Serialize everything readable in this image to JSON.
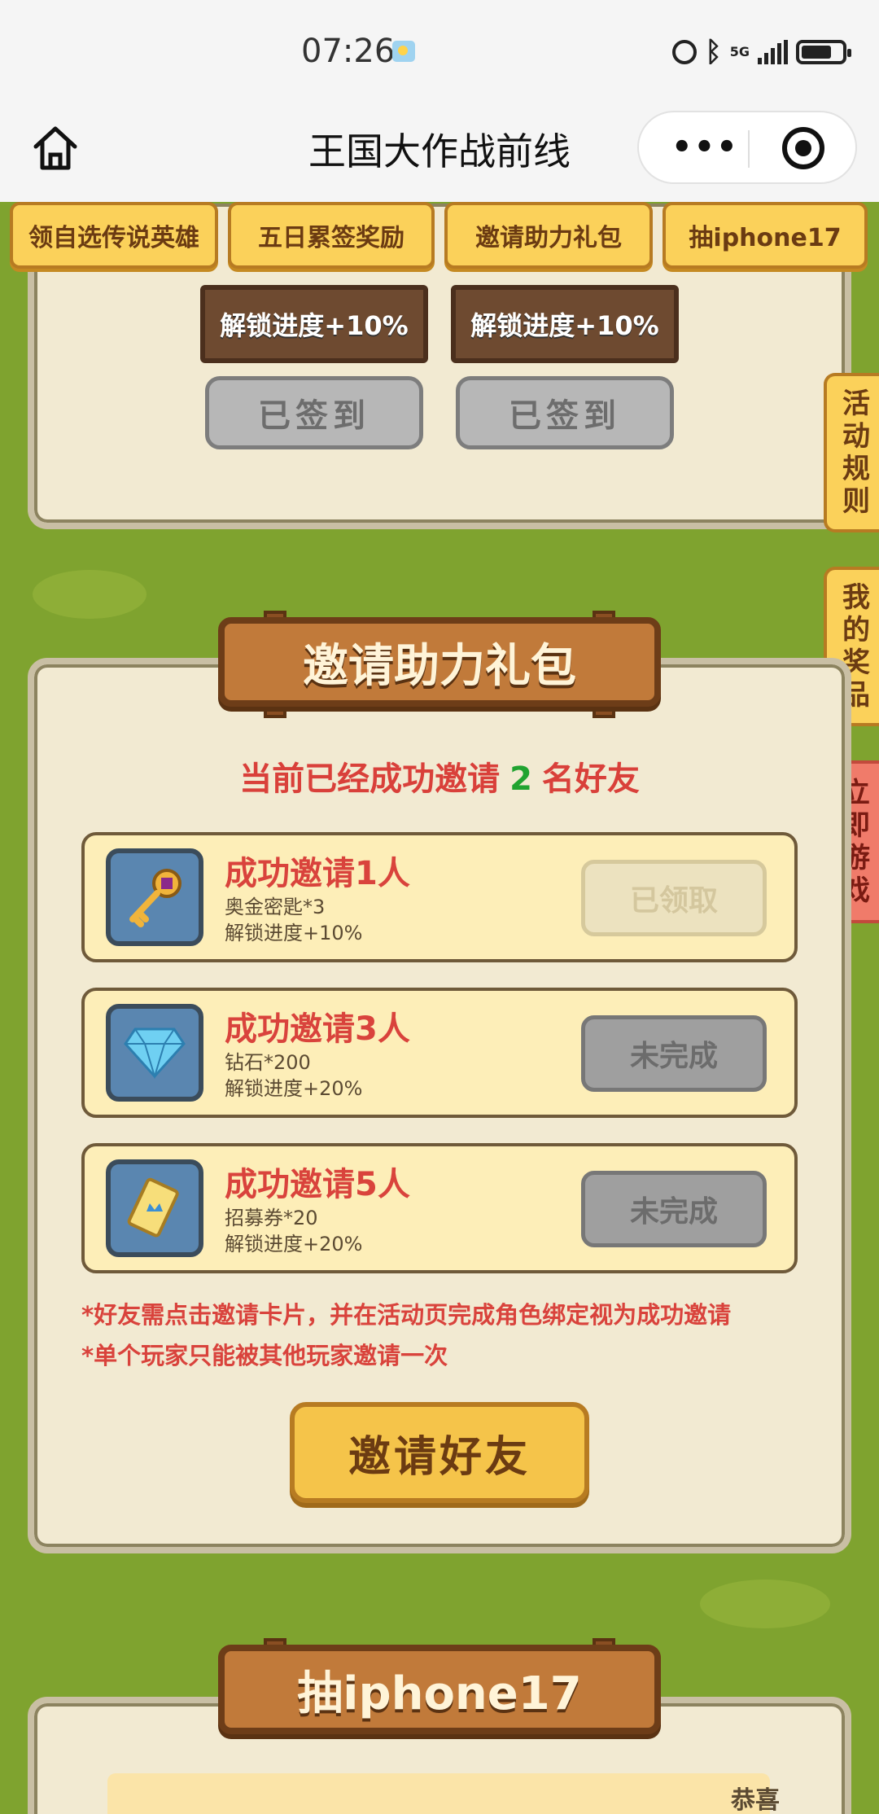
{
  "status_bar": {
    "time": "07:26",
    "network": "5G"
  },
  "nav": {
    "title": "王国大作战前线",
    "more": "•••"
  },
  "tabs": [
    "领自选传说英雄",
    "五日累签奖励",
    "邀请助力礼包",
    "抽iphone17"
  ],
  "checkin": {
    "cards": [
      {
        "unlock": "解锁进度+10%",
        "button": "已签到"
      },
      {
        "unlock": "解锁进度+10%",
        "button": "已签到"
      }
    ]
  },
  "side_tabs": [
    "活动规则",
    "我的奖品",
    "立即游戏"
  ],
  "invite": {
    "title": "邀请助力礼包",
    "status_prefix": "当前已经成功邀请",
    "status_count": "2",
    "status_suffix": "名好友",
    "rewards": [
      {
        "icon": "key-icon",
        "title": "成功邀请1人",
        "item": "奥金密匙*3",
        "progress": "解锁进度+10%",
        "button": "已领取",
        "state": "claimed"
      },
      {
        "icon": "diamond-icon",
        "title": "成功邀请3人",
        "item": "钻石*200",
        "progress": "解锁进度+20%",
        "button": "未完成",
        "state": "pending"
      },
      {
        "icon": "ticket-icon",
        "title": "成功邀请5人",
        "item": "招募券*20",
        "progress": "解锁进度+20%",
        "button": "未完成",
        "state": "pending"
      }
    ],
    "notes": [
      "*好友需点击邀请卡片，并在活动页完成角色绑定视为成功邀请",
      "*单个玩家只能被其他玩家邀请一次"
    ],
    "invite_button": "邀请好友"
  },
  "iphone": {
    "title": "抽iphone17",
    "congrats": "恭喜"
  },
  "colors": {
    "background": "#7fa32f",
    "accent": "#fbd15a",
    "highlight": "#d9433c",
    "count": "#21a330"
  }
}
